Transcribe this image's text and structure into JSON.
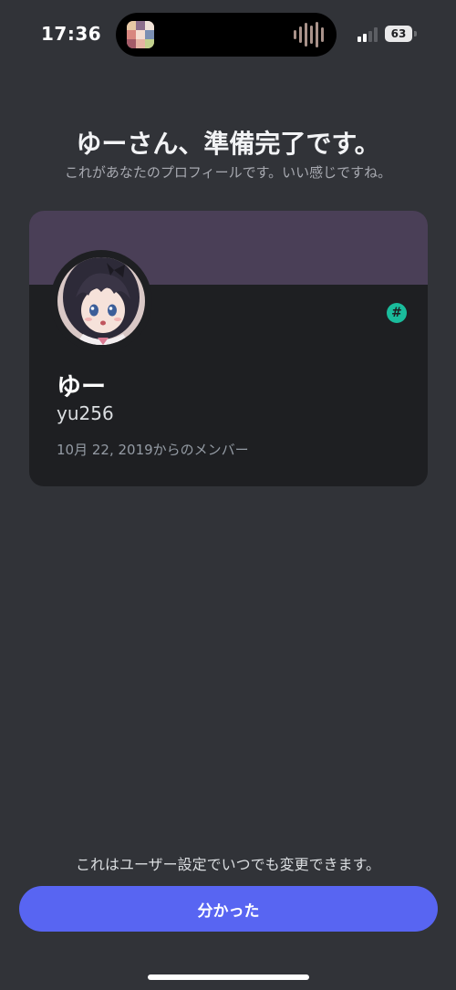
{
  "status_bar": {
    "time": "17:36",
    "battery_level": "63",
    "signal_bars_active": 2,
    "signal_bars_total": 4,
    "icons": [
      "album-art-icon",
      "audio-waveform-icon",
      "signal-icon",
      "battery-icon"
    ]
  },
  "header": {
    "title": "ゆーさん、準備完了です。",
    "subtitle": "これがあなたのプロフィールです。いい感じですね。"
  },
  "profile": {
    "display_name": "ゆー",
    "username": "yu256",
    "member_since": "10月 22, 2019からのメンバー",
    "badge_icon": "hash-badge-icon",
    "badge_symbol": "#",
    "banner_color": "#4a3f57",
    "badge_color": "#1abc9c"
  },
  "footer": {
    "note": "これはユーザー設定でいつでも変更できます。",
    "button_label": "分かった",
    "button_color": "#5865f2"
  },
  "theme": {
    "background": "#313338",
    "card_background": "#1e1f22"
  }
}
